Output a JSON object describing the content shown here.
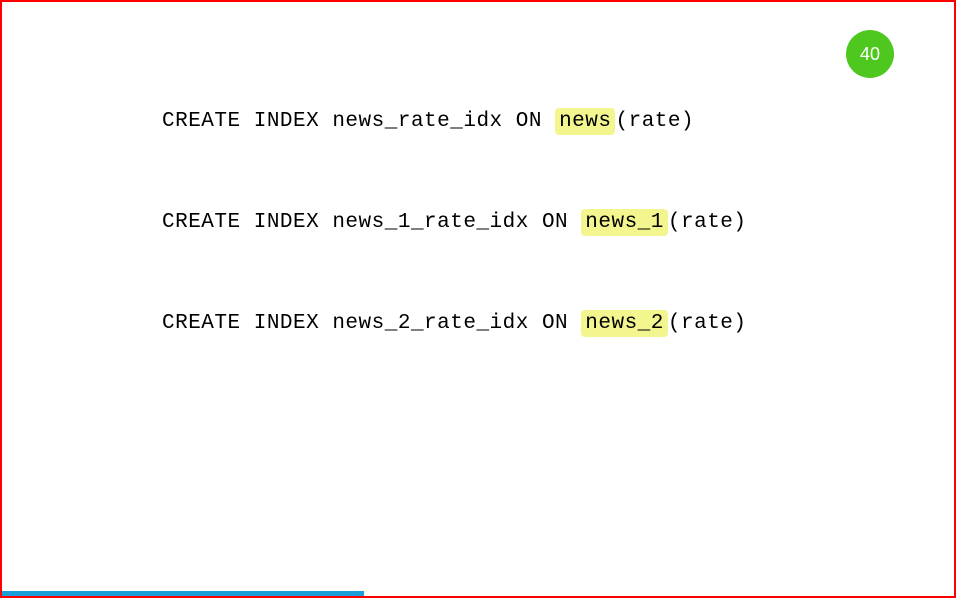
{
  "page_number": "40",
  "lines": [
    {
      "prefix": "CREATE INDEX news_rate_idx ON ",
      "highlight": "news",
      "suffix": "(rate)"
    },
    {
      "prefix": "CREATE INDEX news_1_rate_idx ON ",
      "highlight": "news_1",
      "suffix": "(rate)"
    },
    {
      "prefix": "CREATE INDEX news_2_rate_idx ON ",
      "highlight": "news_2",
      "suffix": "(rate)"
    }
  ],
  "progress_percent": 38
}
